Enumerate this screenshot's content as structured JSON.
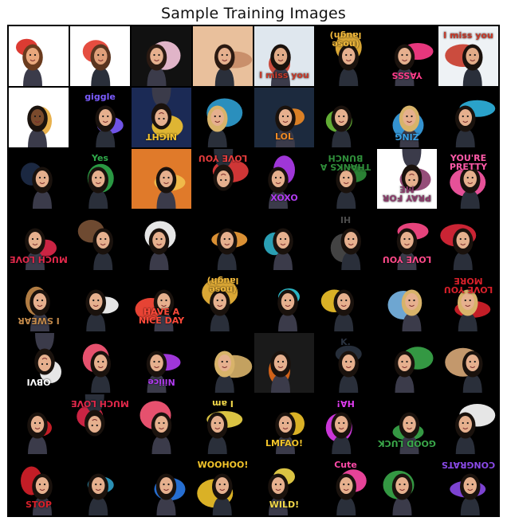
{
  "title": "Sample Training Images",
  "tiles": [
    {
      "bg": "#ffffff",
      "accent": "#d8261c",
      "skin": "#e8a77c",
      "hair": "#6a3b1e",
      "cap": ""
    },
    {
      "bg": "#ffffff",
      "accent": "#e23a2b",
      "skin": "#e0a07a",
      "hair": "#5a3520",
      "cap": ""
    },
    {
      "bg": "#111111",
      "accent": "#f7c6dd",
      "skin": "#e6b08e",
      "hair": "#2b1a12",
      "cap": ""
    },
    {
      "bg": "#e9c09c",
      "accent": "#c58a66",
      "skin": "#e6b08e",
      "hair": "#2b1a12",
      "cap": ""
    },
    {
      "bg": "#dfe7ee",
      "accent": "#c73a2a",
      "skin": "#e2ac88",
      "hair": "#1a120d",
      "cap": "I miss you"
    },
    {
      "bg": "#000000",
      "accent": "#f2b93b",
      "skin": "#e6b08e",
      "hair": "#1a120d",
      "cap": "(nose laugh)",
      "flip": true
    },
    {
      "bg": "#000000",
      "accent": "#ff3d8b",
      "skin": "#e6b08e",
      "hair": "#1a120d",
      "cap": "YASSS",
      "flip": true
    },
    {
      "bg": "#eef2f5",
      "accent": "#c73a2a",
      "skin": "#e2ac88",
      "hair": "#1a120d",
      "cap": "I miss you"
    },
    {
      "bg": "#ffffff",
      "accent": "#e6a93a",
      "skin": "#7a4a2c",
      "hair": "#1a120d",
      "cap": ""
    },
    {
      "bg": "#000000",
      "accent": "#7b5cff",
      "skin": "#e6b08e",
      "hair": "#1a120d",
      "cap": "giggle"
    },
    {
      "bg": "#1b2a55",
      "accent": "#f4c430",
      "skin": "#e6b08e",
      "hair": "#1a120d",
      "cap": "NIGHT",
      "flip": true
    },
    {
      "bg": "#000000",
      "accent": "#2f9fd1",
      "skin": "#e6b08e",
      "hair": "#d8b36a",
      "cap": ""
    },
    {
      "bg": "#1c2a3e",
      "accent": "#f08a24",
      "skin": "#e6b08e",
      "hair": "#1a120d",
      "cap": "LOL"
    },
    {
      "bg": "#000000",
      "accent": "#6cbf3a",
      "skin": "#e6b08e",
      "hair": "#1a120d",
      "cap": ""
    },
    {
      "bg": "#000000",
      "accent": "#3aa2e6",
      "skin": "#e6b08e",
      "hair": "#d8b36a",
      "cap": "ZING",
      "flip": true
    },
    {
      "bg": "#000000",
      "accent": "#2fb4e0",
      "skin": "#e6b08e",
      "hair": "#1a120d",
      "cap": ""
    },
    {
      "bg": "#000000",
      "accent": "#1e2c48",
      "skin": "#e6b08e",
      "hair": "#1a120d",
      "cap": ""
    },
    {
      "bg": "#000000",
      "accent": "#2fa94a",
      "skin": "#e6b08e",
      "hair": "#1a120d",
      "cap": "Yes"
    },
    {
      "bg": "#e07a2a",
      "accent": "#f2c14e",
      "skin": "#e6b08e",
      "hair": "#1a120d",
      "cap": ""
    },
    {
      "bg": "#000000",
      "accent": "#e63c3c",
      "skin": "#e6b08e",
      "hair": "#1a120d",
      "cap": "LOVE YOU",
      "flip": true
    },
    {
      "bg": "#000000",
      "accent": "#b03cf0",
      "skin": "#e6b08e",
      "hair": "#1a120d",
      "cap": "XOXO"
    },
    {
      "bg": "#000000",
      "accent": "#2f8f3a",
      "skin": "#e6b08e",
      "hair": "#1a120d",
      "cap": "THANKS A BUNCH",
      "flip": true
    },
    {
      "bg": "#ffffff",
      "accent": "#8a3a6a",
      "skin": "#e6b08e",
      "hair": "#1a120d",
      "cap": "PRAY FOR ME",
      "flip": true
    },
    {
      "bg": "#000000",
      "accent": "#ff5aa8",
      "skin": "#e6b08e",
      "hair": "#1a120d",
      "cap": "YOU'RE PRETTY"
    },
    {
      "bg": "#000000",
      "accent": "#e0284a",
      "skin": "#e6b08e",
      "hair": "#1a120d",
      "cap": "MUCH LOVE",
      "flip": true
    },
    {
      "bg": "#000000",
      "accent": "#7a5236",
      "skin": "#e6b08e",
      "hair": "#1a120d",
      "cap": ""
    },
    {
      "bg": "#000000",
      "accent": "#ffffff",
      "skin": "#e6b08e",
      "hair": "#1a120d",
      "cap": ""
    },
    {
      "bg": "#000000",
      "accent": "#f2a03a",
      "skin": "#e6b08e",
      "hair": "#1a120d",
      "cap": ""
    },
    {
      "bg": "#000000",
      "accent": "#2fb0c8",
      "skin": "#e6b08e",
      "hair": "#1a120d",
      "cap": ""
    },
    {
      "bg": "#000000",
      "accent": "#4a4a4a",
      "skin": "#e6b08e",
      "hair": "#1a120d",
      "cap": "HI",
      "flip": true
    },
    {
      "bg": "#000000",
      "accent": "#ff4a8a",
      "skin": "#e6b08e",
      "hair": "#1a120d",
      "cap": "LOVE YOU",
      "flip": true
    },
    {
      "bg": "#000000",
      "accent": "#e0283a",
      "skin": "#e6b08e",
      "hair": "#1a120d",
      "cap": ""
    },
    {
      "bg": "#000000",
      "accent": "#c48a4a",
      "skin": "#e6b08e",
      "hair": "#1a120d",
      "cap": "I SWEAR",
      "flip": true
    },
    {
      "bg": "#000000",
      "accent": "#ffffff",
      "skin": "#e6b08e",
      "hair": "#1a120d",
      "cap": ""
    },
    {
      "bg": "#000000",
      "accent": "#ff4a3a",
      "skin": "#e6b08e",
      "hair": "#1a120d",
      "cap": "HAVE A NICE DAY"
    },
    {
      "bg": "#000000",
      "accent": "#f2b93b",
      "skin": "#e6b08e",
      "hair": "#1a120d",
      "cap": "(nose laugh)",
      "flip": true
    },
    {
      "bg": "#000000",
      "accent": "#2fc8d8",
      "skin": "#e6b08e",
      "hair": "#1a120d",
      "cap": ""
    },
    {
      "bg": "#000000",
      "accent": "#f2c42a",
      "skin": "#e6b08e",
      "hair": "#1a120d",
      "cap": ""
    },
    {
      "bg": "#000000",
      "accent": "#7ab8e8",
      "skin": "#e6b08e",
      "hair": "#d8b36a",
      "cap": ""
    },
    {
      "bg": "#000000",
      "accent": "#d8202a",
      "skin": "#e6b08e",
      "hair": "#d8b36a",
      "cap": "LOVE YOU MORE",
      "flip": true
    },
    {
      "bg": "#000000",
      "accent": "#ffffff",
      "skin": "#e6b08e",
      "hair": "#1a120d",
      "cap": "OBVI",
      "flip": true
    },
    {
      "bg": "#000000",
      "accent": "#ff5a7a",
      "skin": "#e6b08e",
      "hair": "#1a120d",
      "cap": ""
    },
    {
      "bg": "#000000",
      "accent": "#b03cf0",
      "skin": "#e6b08e",
      "hair": "#1a120d",
      "cap": "Niiice",
      "flip": true
    },
    {
      "bg": "#000000",
      "accent": "#d8b36a",
      "skin": "#e6b08e",
      "hair": "#d8b36a",
      "cap": ""
    },
    {
      "bg": "#1a1a1a",
      "accent": "#e66a1a",
      "skin": "#e6b08e",
      "hair": "#1a120d",
      "cap": ""
    },
    {
      "bg": "#000000",
      "accent": "#2a3340",
      "skin": "#e6b08e",
      "hair": "#1a120d",
      "cap": "K."
    },
    {
      "bg": "#000000",
      "accent": "#3aa84a",
      "skin": "#e6b08e",
      "hair": "#1a120d",
      "cap": ""
    },
    {
      "bg": "#000000",
      "accent": "#d8a878",
      "skin": "#e6b08e",
      "hair": "#1a120d",
      "cap": ""
    },
    {
      "bg": "#000000",
      "accent": "#d8202a",
      "skin": "#e6b08e",
      "hair": "#1a120d",
      "cap": ""
    },
    {
      "bg": "#000000",
      "accent": "#e0284a",
      "skin": "#e6b08e",
      "hair": "#1a120d",
      "cap": "MUCH LOVE",
      "flip": true
    },
    {
      "bg": "#000000",
      "accent": "#ff5a7a",
      "skin": "#e6b08e",
      "hair": "#1a120d",
      "cap": ""
    },
    {
      "bg": "#000000",
      "accent": "#f2d84a",
      "skin": "#e6b08e",
      "hair": "#1a120d",
      "cap": "I am",
      "flip": true
    },
    {
      "bg": "#000000",
      "accent": "#f2c42a",
      "skin": "#e6b08e",
      "hair": "#1a120d",
      "cap": "LMFAO!"
    },
    {
      "bg": "#000000",
      "accent": "#e03cf0",
      "skin": "#e6b08e",
      "hair": "#1a120d",
      "cap": "HA!",
      "flip": true
    },
    {
      "bg": "#000000",
      "accent": "#3aa84a",
      "skin": "#e6b08e",
      "hair": "#1a120d",
      "cap": "GOOD LUCK",
      "flip": true
    },
    {
      "bg": "#000000",
      "accent": "#ffffff",
      "skin": "#e6b08e",
      "hair": "#1a120d",
      "cap": ""
    },
    {
      "bg": "#000000",
      "accent": "#d8202a",
      "skin": "#e6b08e",
      "hair": "#1a120d",
      "cap": "STOP"
    },
    {
      "bg": "#000000",
      "accent": "#2fa0c8",
      "skin": "#e6b08e",
      "hair": "#1a120d",
      "cap": ""
    },
    {
      "bg": "#000000",
      "accent": "#2a7ae8",
      "skin": "#e6b08e",
      "hair": "#1a120d",
      "cap": ""
    },
    {
      "bg": "#000000",
      "accent": "#f2c42a",
      "skin": "#e6b08e",
      "hair": "#1a120d",
      "cap": "WOOHOO!"
    },
    {
      "bg": "#000000",
      "accent": "#f2d84a",
      "skin": "#e6b08e",
      "hair": "#1a120d",
      "cap": "WILD!"
    },
    {
      "bg": "#000000",
      "accent": "#ff4aa8",
      "skin": "#e6b08e",
      "hair": "#1a120d",
      "cap": "Cute"
    },
    {
      "bg": "#000000",
      "accent": "#3aa84a",
      "skin": "#e6b08e",
      "hair": "#1a120d",
      "cap": ""
    },
    {
      "bg": "#000000",
      "accent": "#8a4ae8",
      "skin": "#e6b08e",
      "hair": "#1a120d",
      "cap": "CONGRATS",
      "flip": true
    }
  ]
}
